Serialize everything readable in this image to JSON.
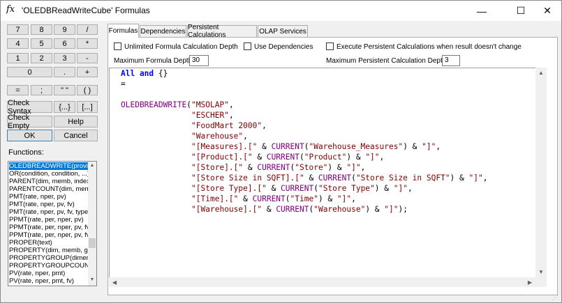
{
  "window": {
    "title": "'OLEDBReadWriteCube' Formulas",
    "app_icon_glyph": "fx",
    "controls": {
      "minimize": "—",
      "maximize": "☐",
      "close": "✕"
    }
  },
  "keypad": {
    "row1": [
      "7",
      "8",
      "9",
      "/"
    ],
    "row2": [
      "4",
      "5",
      "6",
      "*"
    ],
    "row3": [
      "1",
      "2",
      "3",
      "-"
    ],
    "row4": [
      "0",
      ".",
      "+"
    ],
    "row5": [
      "=",
      ";",
      "\" \"",
      "( )"
    ],
    "check_syntax": "Check Syntax",
    "braces": "{...}",
    "brackets": "[...]",
    "check_empty": "Check Empty",
    "help": "Help",
    "ok": "OK",
    "cancel": "Cancel"
  },
  "functions": {
    "label": "Functions:",
    "items": [
      "OLEDBREADWRITE(provi",
      "OR(condition, condition, ...)",
      "PARENT(dim, memb, index",
      "PARENTCOUNT(dim, mem",
      "PMT(rate, nper, pv)",
      "PMT(rate, nper, pv, fv)",
      "PMT(rate, nper, pv, fv, type",
      "PPMT(rate, per, nper, pv)",
      "PPMT(rate, per, nper, pv, fv",
      "PPMT(rate, per, nper, pv, fv",
      "PROPER(text)",
      "PROPERTY(dim, memb, gr",
      "PROPERTYGROUP(dimen",
      "PROPERTYGROUPCOUN",
      "PV(rate, nper, pmt)",
      "PV(rate, nper, pmt, fv)"
    ]
  },
  "tabs": [
    "Formulas",
    "Dependencies",
    "Persistent Calculations",
    "OLAP Services"
  ],
  "options": {
    "unlimited_depth": "Unlimited Formula Calculation Depth",
    "use_dependencies": "Use Dependencies",
    "execute_persistent": "Execute Persistent Calculations when result doesn't change",
    "max_formula_depth_label": "Maximum Formula Depth:",
    "max_formula_depth_value": "30",
    "max_persistent_depth_label": "Maximum Persistent Calculation Depth:",
    "max_persistent_depth_value": "3"
  },
  "editor": {
    "lines": [
      [
        [
          "kw",
          "All and "
        ],
        [
          "op",
          "{}"
        ]
      ],
      [
        [
          "op",
          "="
        ]
      ],
      [
        [
          "op",
          ""
        ]
      ],
      [
        [
          "fn",
          "OLEDBREADWRITE"
        ],
        [
          "op",
          "("
        ],
        [
          "str",
          "\"MSOLAP\""
        ],
        [
          "op",
          ","
        ]
      ],
      [
        [
          "op",
          "               "
        ],
        [
          "str",
          "\"ESCHER\""
        ],
        [
          "op",
          ","
        ]
      ],
      [
        [
          "op",
          "               "
        ],
        [
          "str",
          "\"FoodMart 2000\""
        ],
        [
          "op",
          ","
        ]
      ],
      [
        [
          "op",
          "               "
        ],
        [
          "str",
          "\"Warehouse\""
        ],
        [
          "op",
          ","
        ]
      ],
      [
        [
          "op",
          "               "
        ],
        [
          "str",
          "\"[Measures].[\""
        ],
        [
          "op",
          " & "
        ],
        [
          "fn",
          "CURRENT"
        ],
        [
          "op",
          "("
        ],
        [
          "str",
          "\"Warehouse_Measures\""
        ],
        [
          "op",
          ") & "
        ],
        [
          "str",
          "\"]\""
        ],
        [
          "op",
          ","
        ]
      ],
      [
        [
          "op",
          "               "
        ],
        [
          "str",
          "\"[Product].[\""
        ],
        [
          "op",
          " & "
        ],
        [
          "fn",
          "CURRENT"
        ],
        [
          "op",
          "("
        ],
        [
          "str",
          "\"Product\""
        ],
        [
          "op",
          ") & "
        ],
        [
          "str",
          "\"]\""
        ],
        [
          "op",
          ","
        ]
      ],
      [
        [
          "op",
          "               "
        ],
        [
          "str",
          "\"[Store].[\""
        ],
        [
          "op",
          " & "
        ],
        [
          "fn",
          "CURRENT"
        ],
        [
          "op",
          "("
        ],
        [
          "str",
          "\"Store\""
        ],
        [
          "op",
          ") & "
        ],
        [
          "str",
          "\"]\""
        ],
        [
          "op",
          ","
        ]
      ],
      [
        [
          "op",
          "               "
        ],
        [
          "str",
          "\"[Store Size in SQFT].[\""
        ],
        [
          "op",
          " & "
        ],
        [
          "fn",
          "CURRENT"
        ],
        [
          "op",
          "("
        ],
        [
          "str",
          "\"Store Size in SQFT\""
        ],
        [
          "op",
          ") & "
        ],
        [
          "str",
          "\"]\""
        ],
        [
          "op",
          ","
        ]
      ],
      [
        [
          "op",
          "               "
        ],
        [
          "str",
          "\"[Store Type].[\""
        ],
        [
          "op",
          " & "
        ],
        [
          "fn",
          "CURRENT"
        ],
        [
          "op",
          "("
        ],
        [
          "str",
          "\"Store Type\""
        ],
        [
          "op",
          ") & "
        ],
        [
          "str",
          "\"]\""
        ],
        [
          "op",
          ","
        ]
      ],
      [
        [
          "op",
          "               "
        ],
        [
          "str",
          "\"[Time].[\""
        ],
        [
          "op",
          " & "
        ],
        [
          "fn",
          "CURRENT"
        ],
        [
          "op",
          "("
        ],
        [
          "str",
          "\"Time\""
        ],
        [
          "op",
          ") & "
        ],
        [
          "str",
          "\"]\""
        ],
        [
          "op",
          ","
        ]
      ],
      [
        [
          "op",
          "               "
        ],
        [
          "str",
          "\"[Warehouse].[\""
        ],
        [
          "op",
          " & "
        ],
        [
          "fn",
          "CURRENT"
        ],
        [
          "op",
          "("
        ],
        [
          "str",
          "\"Warehouse\""
        ],
        [
          "op",
          ") & "
        ],
        [
          "str",
          "\"]\""
        ],
        [
          "op",
          ");"
        ]
      ]
    ]
  }
}
